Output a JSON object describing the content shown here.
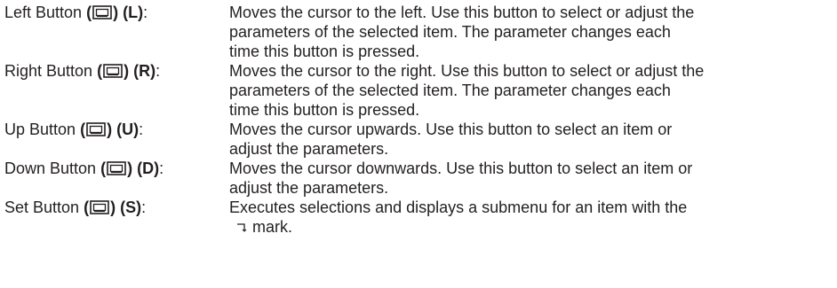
{
  "entries": [
    {
      "name": "Left Button",
      "key": "(L)",
      "lines": [
        "Moves the cursor to the left.  Use this button to select or adjust the",
        "parameters of the selected item.  The parameter changes each",
        "time this button is pressed."
      ]
    },
    {
      "name": "Right Button",
      "key": "(R)",
      "lines": [
        "Moves the cursor to the right.  Use this button to select or adjust the",
        "parameters of the selected item.  The parameter changes each",
        "time this button is pressed."
      ]
    },
    {
      "name": "Up Button",
      "key": "(U)",
      "lines": [
        "Moves the cursor upwards.  Use this button to select an item or",
        "adjust the parameters."
      ]
    },
    {
      "name": "Down Button",
      "key": "(D)",
      "lines": [
        "Moves the cursor downwards.  Use this button to select an item or",
        "adjust the parameters."
      ]
    },
    {
      "name": "Set Button",
      "key": "(S)",
      "lines": [
        "Executes selections and displays a submenu for an item with the",
        "mark."
      ]
    }
  ],
  "symbols": {
    "open_paren": "(",
    "close_paren": ")",
    "colon": ":",
    "button_icon": "button-icon",
    "submenu_mark_icon": "submenu-mark-icon"
  },
  "colors": {
    "text": "#231f20"
  }
}
